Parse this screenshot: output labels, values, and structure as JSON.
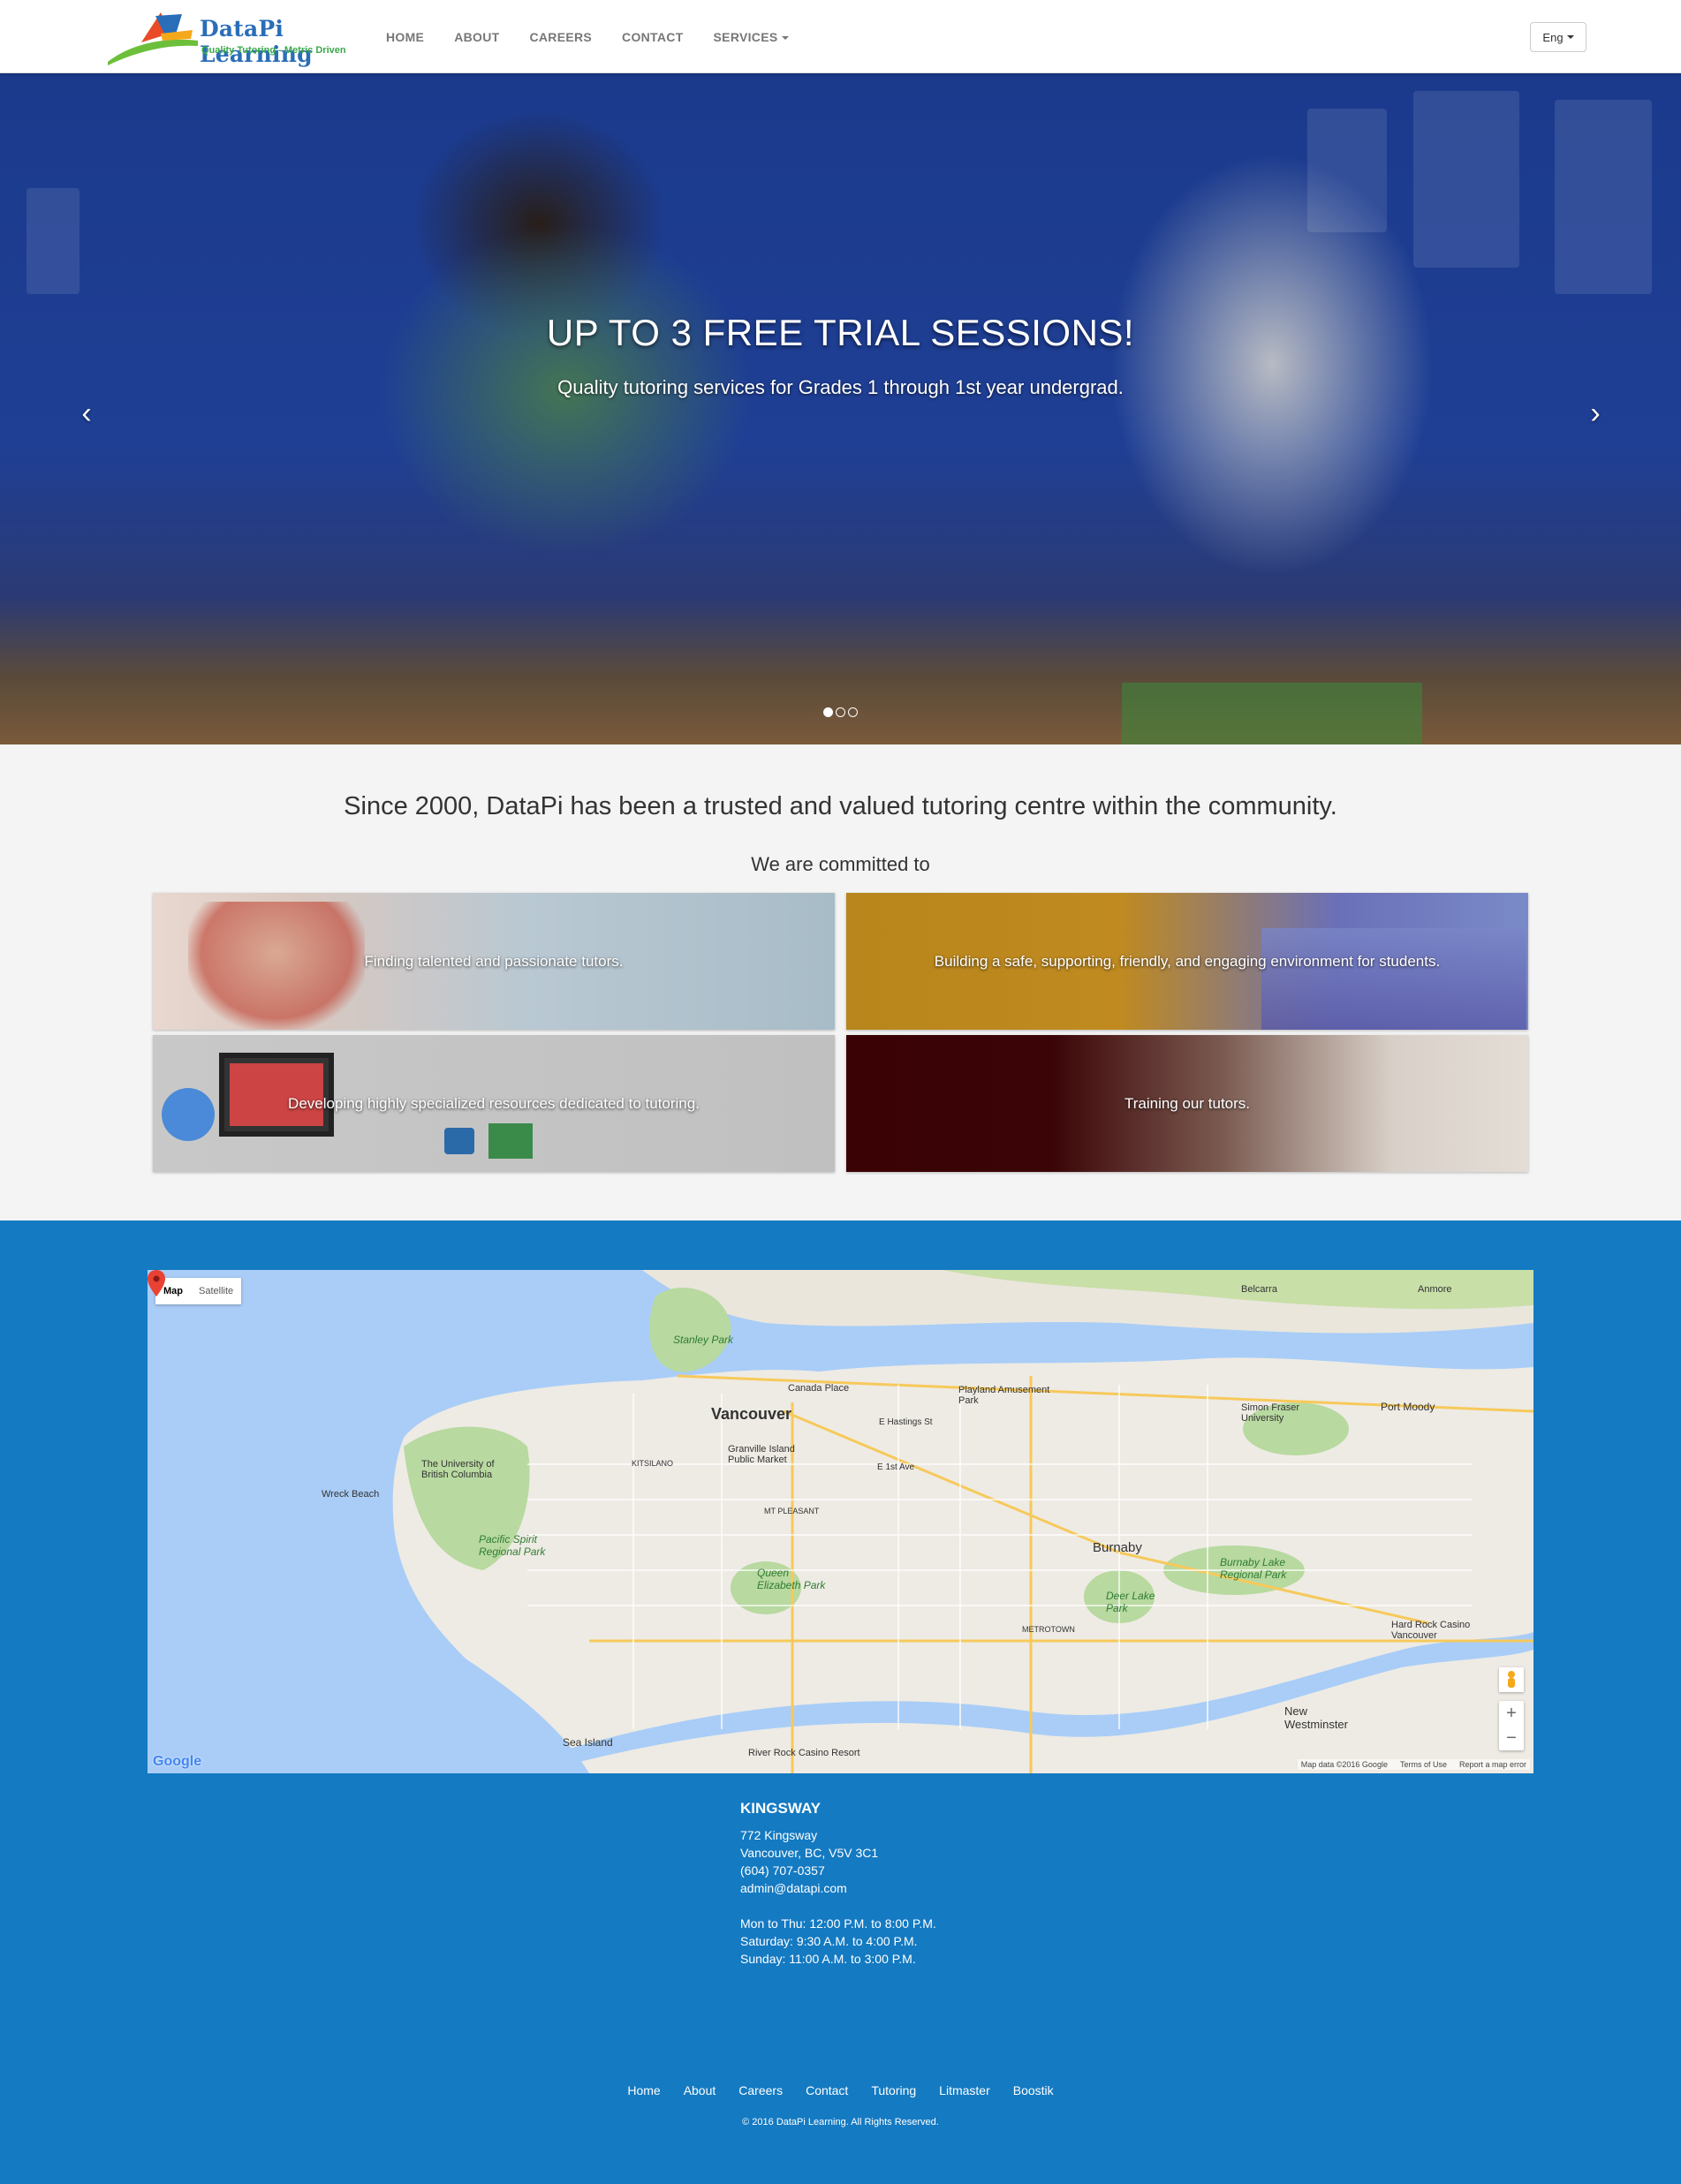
{
  "brand": {
    "name": "DataPi Learning",
    "tagline": "Quality Tutoring - Metric Driven"
  },
  "nav": {
    "items": [
      {
        "label": "HOME"
      },
      {
        "label": "ABOUT"
      },
      {
        "label": "CAREERS"
      },
      {
        "label": "CONTACT"
      },
      {
        "label": "SERVICES"
      }
    ],
    "language": "Eng"
  },
  "hero": {
    "title": "UP TO 3 FREE TRIAL SESSIONS!",
    "subtitle": "Quality tutoring services for Grades 1 through 1st year undergrad.",
    "slide_count": 3,
    "active_slide": 1
  },
  "intro": {
    "headline": "Since 2000, DataPi has been a trusted and valued tutoring centre within the community.",
    "committed": "We are committed to"
  },
  "tiles": [
    {
      "text": "Finding talented and passionate tutors."
    },
    {
      "text": "Building a safe, supporting, friendly, and engaging environment for students."
    },
    {
      "text": "Developing highly specialized resources dedicated to tutoring."
    },
    {
      "text": "Training our tutors."
    }
  ],
  "map": {
    "type_map": "Map",
    "type_satellite": "Satellite",
    "labels": {
      "vancouver": "Vancouver",
      "burnaby": "Burnaby",
      "new_westminster": "New Westminster",
      "canada_place": "Canada Place",
      "stanley_park": "Stanley Park",
      "granville": "Granville Island Public Market",
      "ubc": "The University of British Columbia",
      "wreck_beach": "Wreck Beach",
      "pacific_spirit": "Pacific Spirit Regional Park",
      "queen_elizabeth": "Queen Elizabeth Park",
      "deer_lake": "Deer Lake Park",
      "burnaby_lake": "Burnaby Lake Regional Park",
      "sfu": "Simon Fraser University",
      "port_moody": "Port Moody",
      "playland": "Playland Amusement Park",
      "belcarra": "Belcarra",
      "anmore": "Anmore",
      "sea_island": "Sea Island",
      "river_rock": "River Rock Casino Resort",
      "hard_rock": "Hard Rock Casino Vancouver",
      "metrotown": "METROTOWN",
      "kitsilano": "KITSILANO",
      "mt_pleasant": "MT PLEASANT",
      "e_hastings": "E Hastings St",
      "e_1st": "E 1st Ave"
    },
    "zoom_in": "+",
    "zoom_out": "−",
    "google": "Google",
    "footer": [
      "Map data ©2016 Google",
      "Terms of Use",
      "Report a map error"
    ]
  },
  "location": {
    "name": "KINGSWAY",
    "address1": "772 Kingsway",
    "address2": "Vancouver, BC, V5V 3C1",
    "phone": "(604) 707-0357",
    "email": "admin@datapi.com",
    "hours": [
      "Mon to Thu: 12:00 P.M. to 8:00 P.M.",
      "Saturday: 9:30 A.M. to 4:00 P.M.",
      "Sunday: 11:00 A.M. to 3:00 P.M."
    ]
  },
  "footer": {
    "links": [
      "Home",
      "About",
      "Careers",
      "Contact",
      "Tutoring",
      "Litmaster",
      "Boostik"
    ],
    "copyright": "© 2016 DataPi Learning. All Rights Reserved."
  },
  "colors": {
    "brand_blue": "#147ac2",
    "logo_blue": "#2a6db8",
    "logo_green": "#3aa84a"
  }
}
